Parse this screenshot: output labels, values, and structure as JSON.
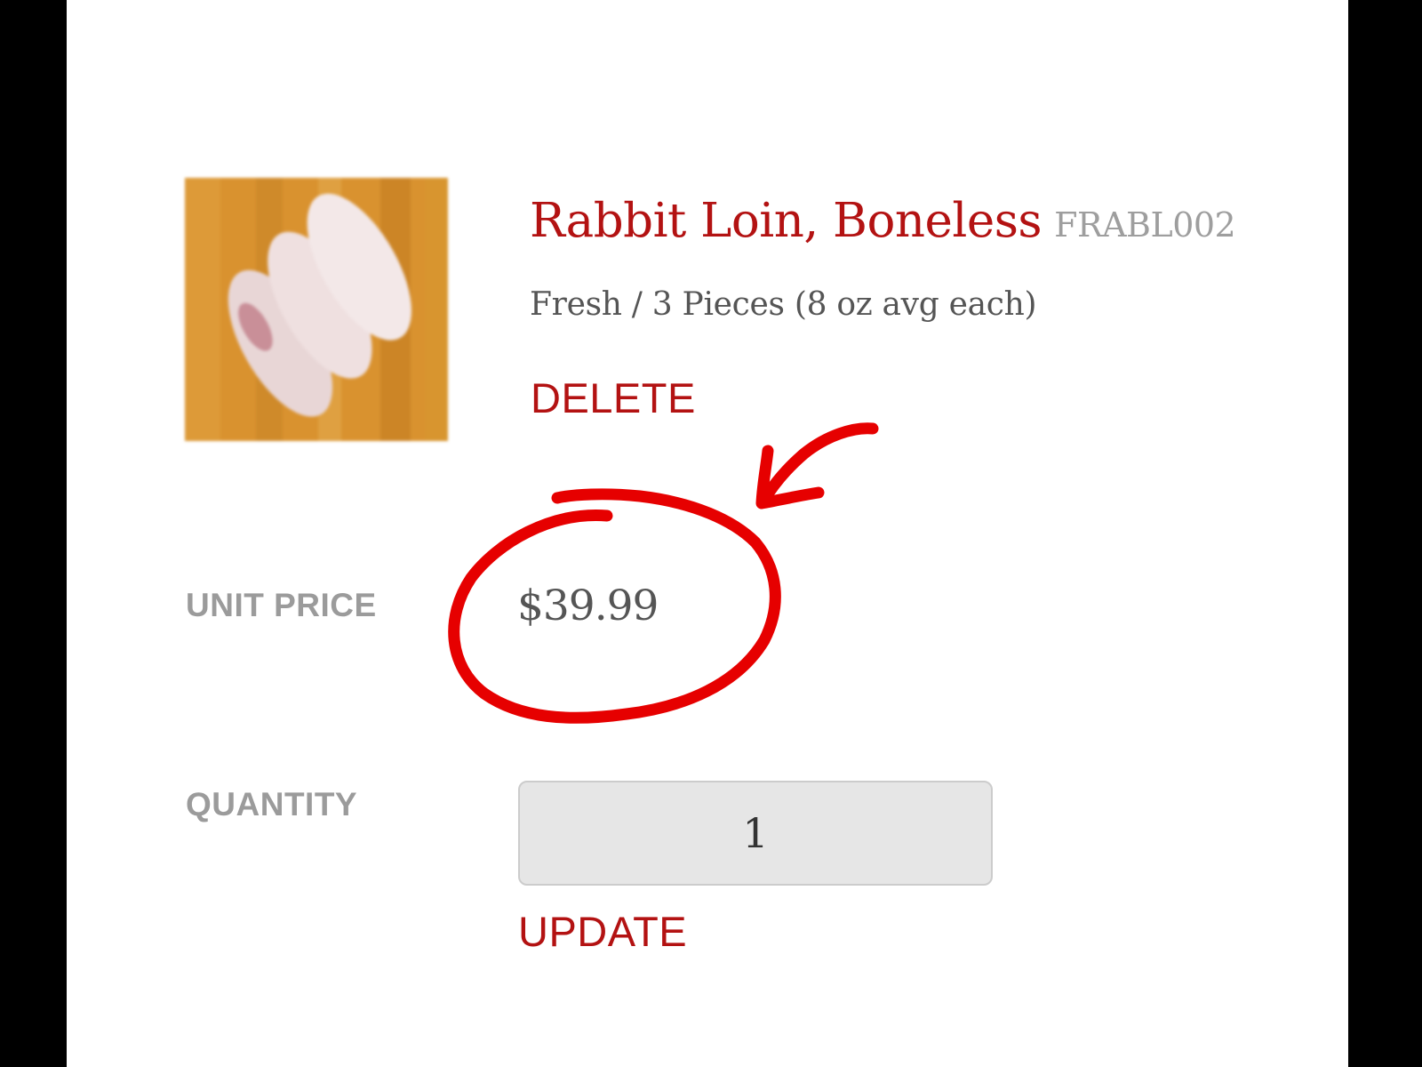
{
  "colors": {
    "accent": "#b31212",
    "label_gray": "#9b9b9b",
    "text_gray": "#555555",
    "input_bg": "#e6e6e6",
    "annotation_red": "#e60000"
  },
  "product": {
    "name": "Rabbit Loin, Boneless",
    "sku": "FRABL002",
    "variant": "Fresh / 3 Pieces (8 oz avg each)",
    "image_icon": "product-photo"
  },
  "actions": {
    "delete_label": "DELETE",
    "update_label": "UPDATE"
  },
  "pricing": {
    "unit_price_label": "UNIT PRICE",
    "unit_price_value": "$39.99"
  },
  "quantity": {
    "label": "QUANTITY",
    "value": "1"
  },
  "annotation": {
    "shapes": [
      "hand-drawn-circle",
      "hand-drawn-arrow"
    ]
  }
}
